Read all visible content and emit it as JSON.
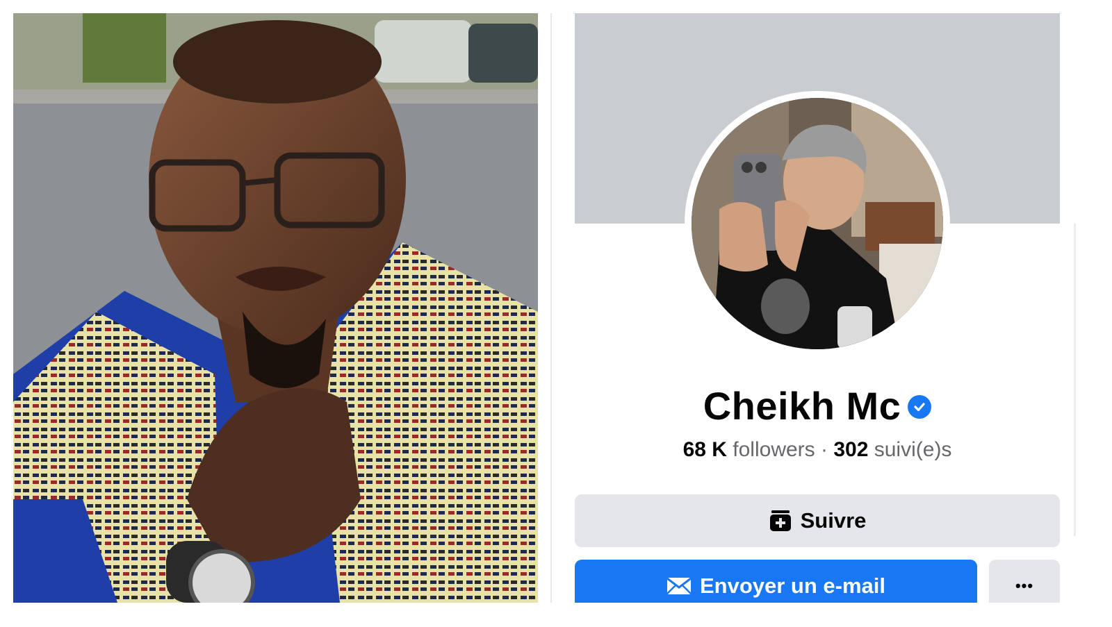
{
  "profile": {
    "name": "Cheikh Mc",
    "verified_icon": "verified-badge-icon",
    "stats": {
      "followers_count": "68 K",
      "followers_label": "followers",
      "separator": "·",
      "following_count": "302",
      "following_label": "suivi(e)s"
    },
    "actions": {
      "follow_label": "Suivre",
      "follow_icon": "add-friend-icon",
      "email_label": "Envoyer un e-mail",
      "email_icon": "envelope-icon",
      "more_label": "•••",
      "more_icon": "more-options-icon"
    }
  },
  "colors": {
    "cover": "#c9ccd1",
    "button_secondary": "#e4e6eb",
    "button_primary": "#1877f2",
    "verified": "#1877f2",
    "text_primary": "#050505",
    "text_secondary": "#65676b"
  }
}
